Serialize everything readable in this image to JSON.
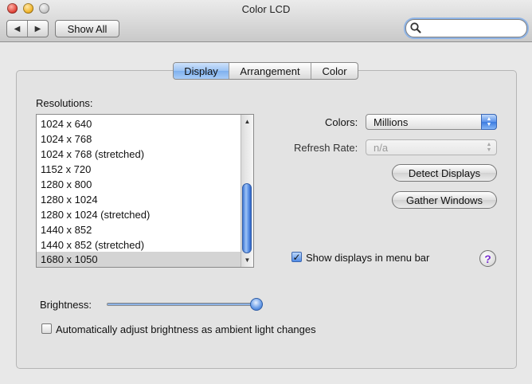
{
  "window": {
    "title": "Color LCD"
  },
  "toolbar": {
    "back_glyph": "◀",
    "forward_glyph": "▶",
    "show_all_label": "Show All",
    "search_value": "",
    "search_placeholder": ""
  },
  "tabs": [
    {
      "label": "Display",
      "selected": true
    },
    {
      "label": "Arrangement",
      "selected": false
    },
    {
      "label": "Color",
      "selected": false
    }
  ],
  "resolutions": {
    "label": "Resolutions:",
    "items": [
      "1024 x 640",
      "1024 x 768",
      "1024 x 768 (stretched)",
      "1152 x 720",
      "1280 x 800",
      "1280 x 1024",
      "1280 x 1024 (stretched)",
      "1440 x 852",
      "1440 x 852 (stretched)",
      "1680 x 1050"
    ],
    "selected_index": 9
  },
  "colors": {
    "label": "Colors:",
    "value": "Millions"
  },
  "refresh_rate": {
    "label": "Refresh Rate:",
    "value": "n/a",
    "enabled": false
  },
  "buttons": {
    "detect_displays": "Detect Displays",
    "gather_windows": "Gather Windows"
  },
  "menu_bar_checkbox": {
    "label": "Show displays in menu bar",
    "checked": true
  },
  "help": {
    "glyph": "?"
  },
  "brightness": {
    "label": "Brightness:",
    "level": 1.0
  },
  "auto_brightness": {
    "label": "Automatically adjust brightness as ambient light changes",
    "checked": false
  },
  "icons": {
    "search": "magnifier-icon",
    "back": "back-arrow-icon",
    "forward": "forward-arrow-icon",
    "scroll_up": "scroll-up-arrow-icon",
    "scroll_down": "scroll-down-arrow-icon",
    "popup": "popup-stepper-icon",
    "help": "help-icon"
  },
  "colors_theme": {
    "accent": "#5e93e6",
    "help_mark": "#7a2fd0"
  }
}
